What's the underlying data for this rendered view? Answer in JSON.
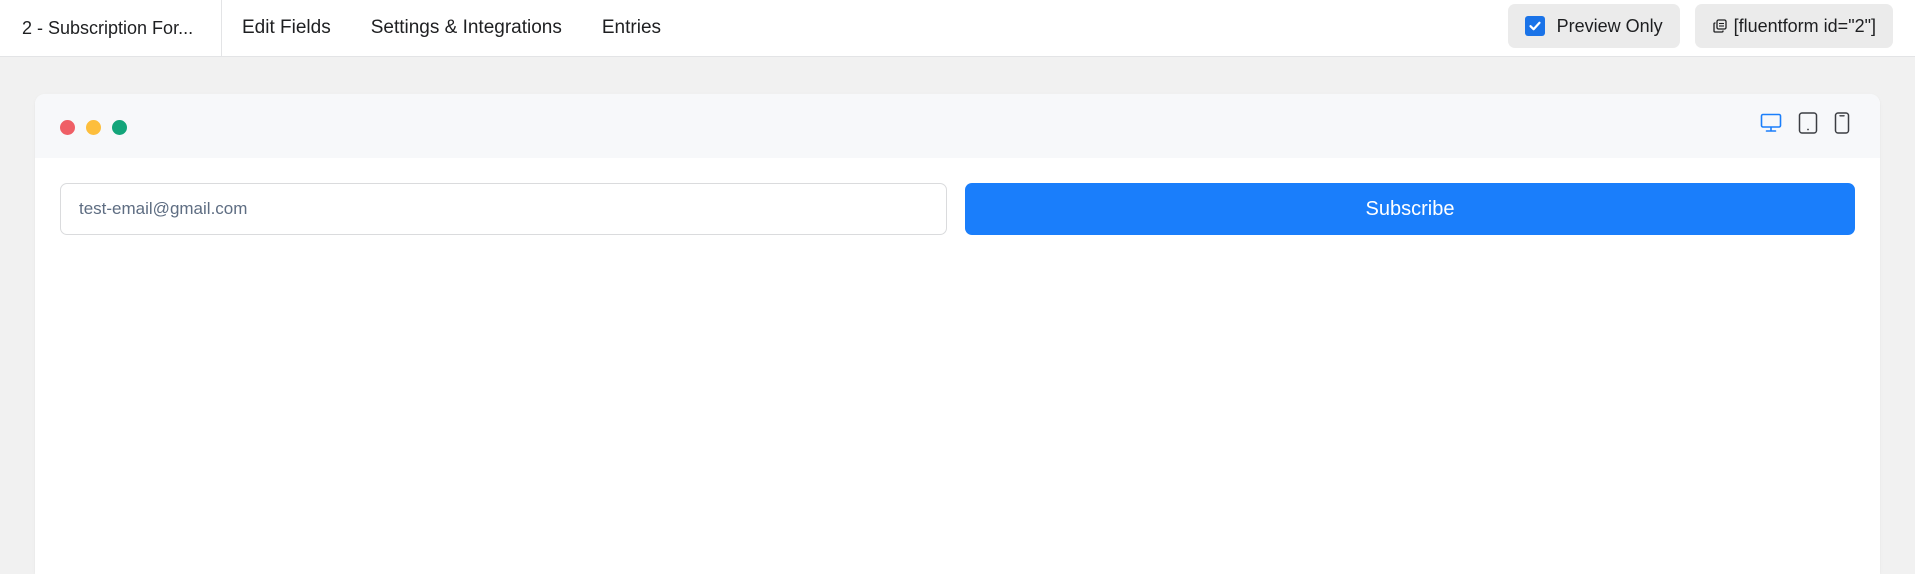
{
  "header": {
    "form_title": "2 - Subscription For...",
    "nav": [
      {
        "label": "Edit Fields"
      },
      {
        "label": "Settings & Integrations"
      },
      {
        "label": "Entries"
      }
    ],
    "preview_only_label": "Preview Only",
    "preview_only_checked": true,
    "shortcode": "[fluentform id=\"2\"]"
  },
  "preview": {
    "window_dots": [
      "#ef5f66",
      "#fdbe3c",
      "#13a57a"
    ],
    "devices": [
      {
        "name": "desktop",
        "active": true
      },
      {
        "name": "tablet",
        "active": false
      },
      {
        "name": "mobile",
        "active": false
      }
    ],
    "form": {
      "email_placeholder": "test-email@gmail.com",
      "submit_label": "Subscribe"
    }
  },
  "colors": {
    "accent": "#1a7efb",
    "background": "#f1f1f1"
  }
}
